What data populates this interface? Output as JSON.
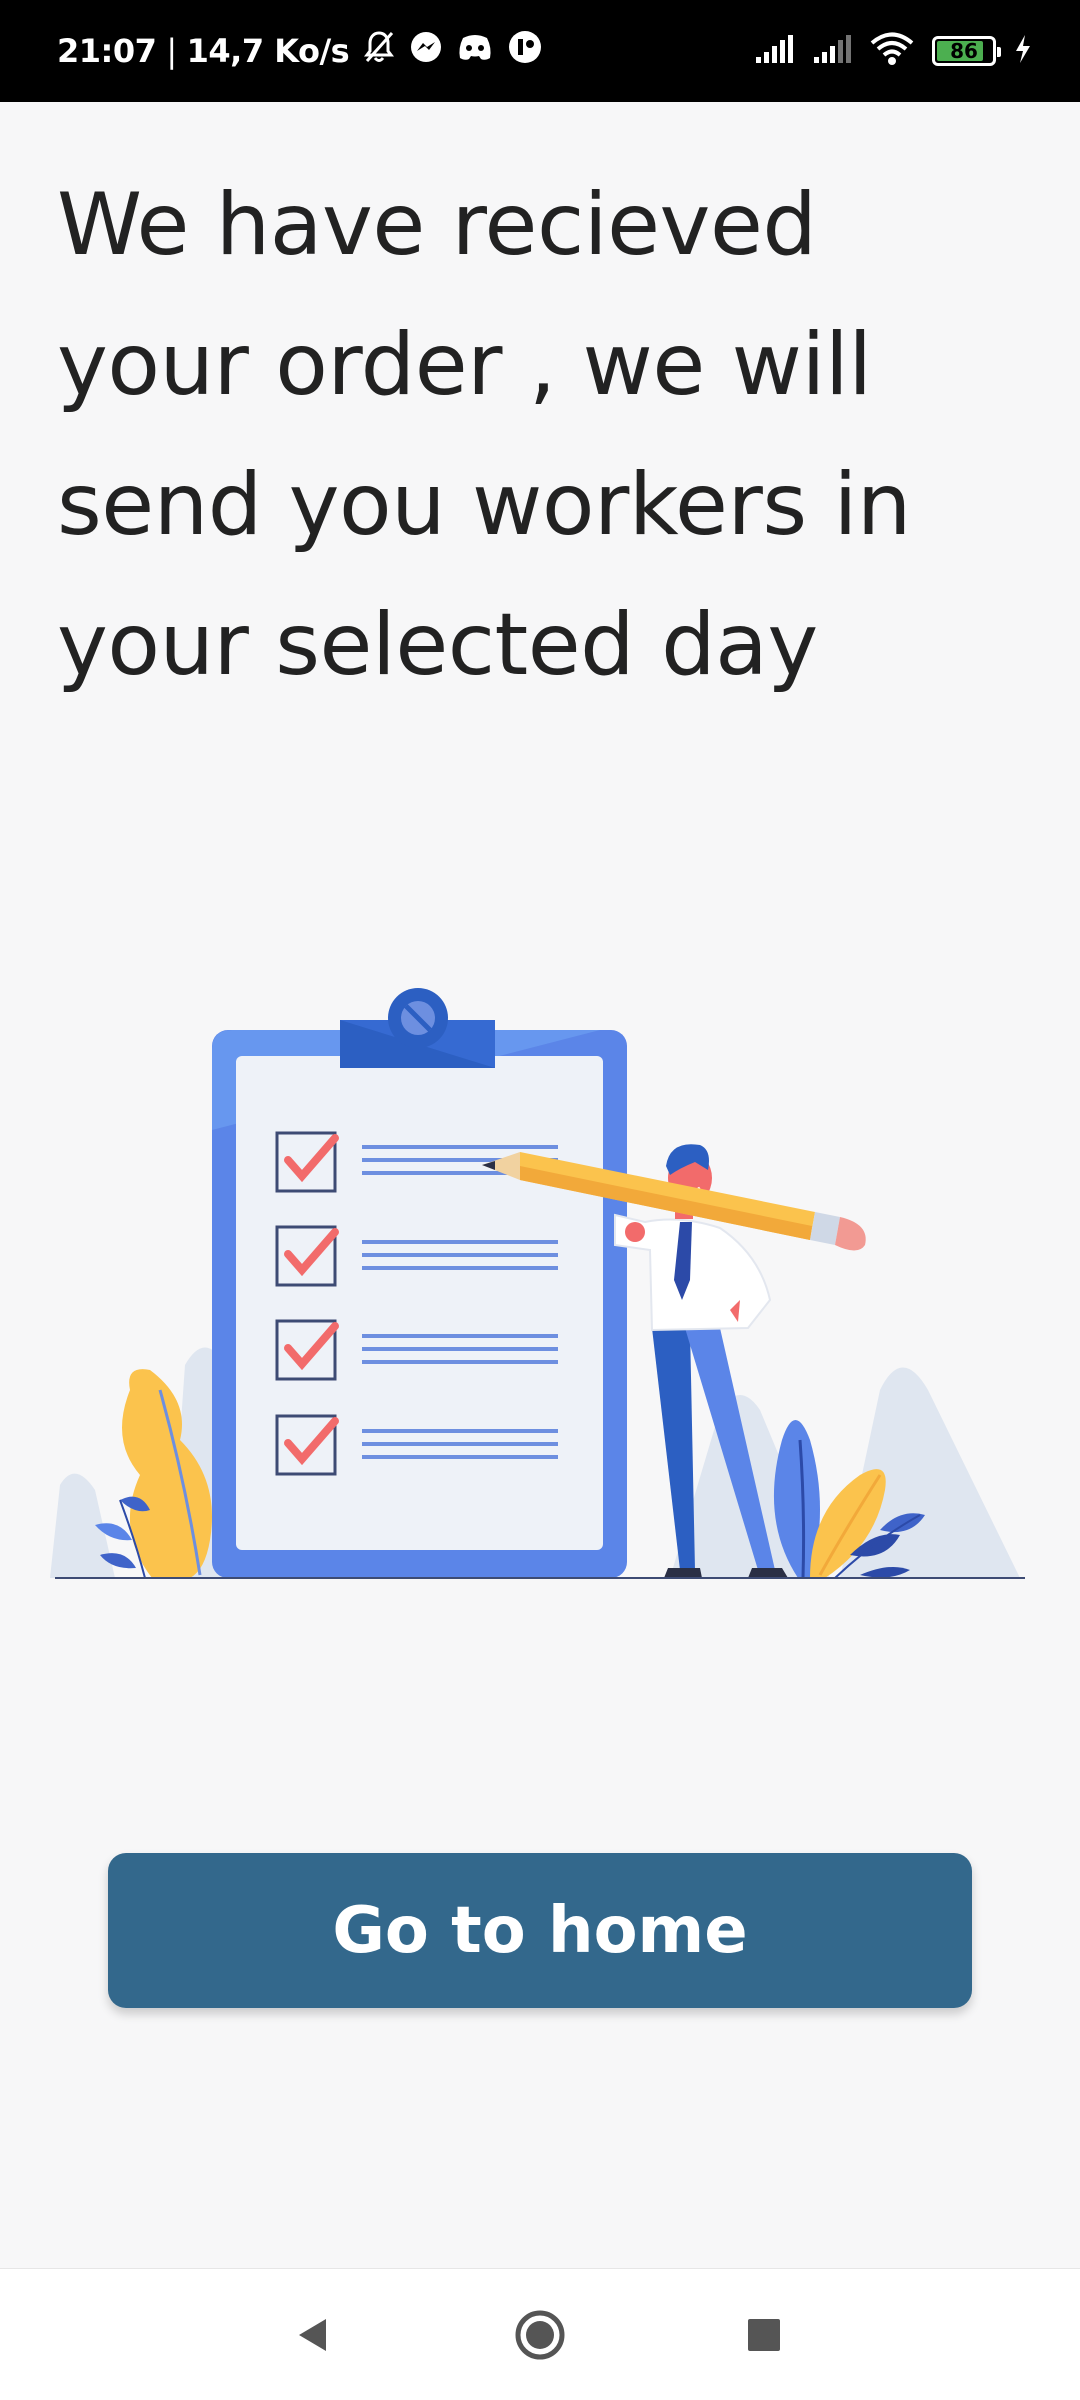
{
  "status_bar": {
    "time": "21:07",
    "separator": "|",
    "network_speed": "14,7 Ko/s",
    "icons": [
      "mute-icon",
      "messenger-icon",
      "discord-icon",
      "app-icon",
      "signal-icon",
      "signal-icon",
      "wifi-icon",
      "battery-icon",
      "charging-icon"
    ],
    "battery_level": "86",
    "battery_fraction": 0.86
  },
  "main": {
    "headline_lines": [
      "We have recieved",
      "your order , we will",
      "send you workers in",
      "your selected day"
    ],
    "illustration_icon": "checklist-illustration",
    "button_label": "Go to home"
  },
  "navigation": {
    "back_icon": "back-triangle-icon",
    "home_icon": "home-circle-icon",
    "recents_icon": "recents-square-icon"
  },
  "colors": {
    "button": "#33688c",
    "clipboard": "#5b85e8",
    "check": "#f26b6b",
    "pencil": "#fbc34d"
  }
}
